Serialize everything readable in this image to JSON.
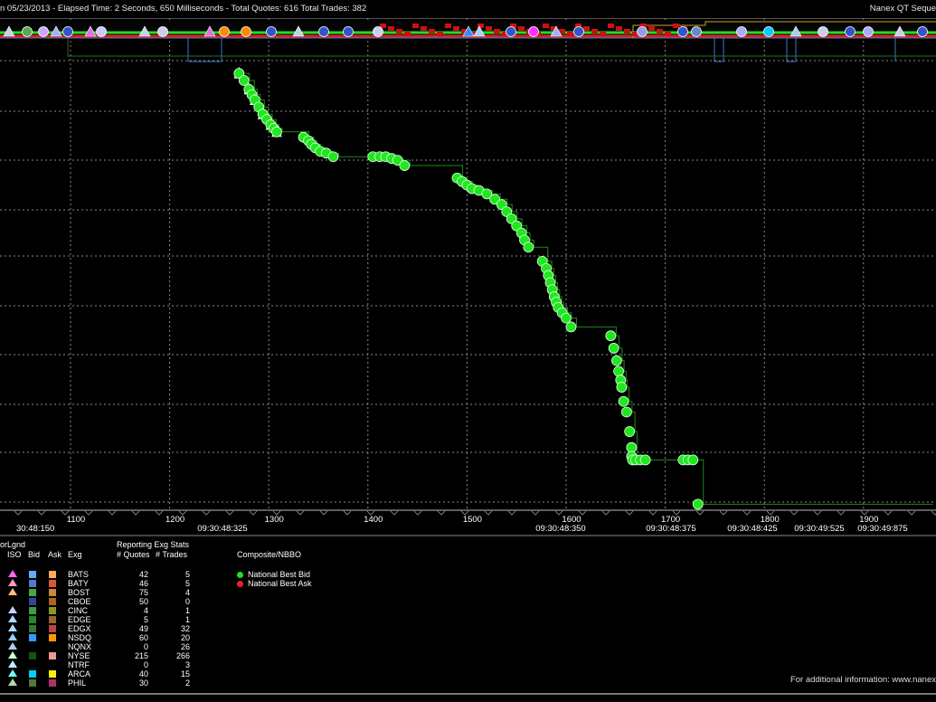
{
  "header": {
    "title": "n 05/23/2013  -  Elapsed Time: 2 Seconds, 650 Milliseconds  -  Total Quotes: 616  Total Trades: 382",
    "brand": "Nanex QT Seque"
  },
  "chart_data": {
    "type": "scatter",
    "title": "",
    "x": {
      "min": 1050,
      "max": 1980,
      "ticks": [
        1100,
        1200,
        1300,
        1400,
        1500,
        1600,
        1700,
        1800,
        1900
      ]
    },
    "time_labels": [
      "30:48:150",
      "09:30:48:325",
      "09:30:48:350",
      "09:30:48:375",
      "09:30:48:425",
      "09:30:49:525",
      "09:30:49:875"
    ],
    "grid": true,
    "series": [
      {
        "name": "National Best Bid",
        "color": "#00ee00",
        "points": [
          [
            1270,
            22
          ],
          [
            1275,
            26
          ],
          [
            1280,
            31
          ],
          [
            1283,
            34
          ],
          [
            1286,
            37
          ],
          [
            1290,
            41
          ],
          [
            1294,
            45
          ],
          [
            1298,
            48
          ],
          [
            1302,
            51
          ],
          [
            1305,
            53
          ],
          [
            1308,
            55
          ],
          [
            1335,
            58
          ],
          [
            1340,
            60
          ],
          [
            1343,
            62
          ],
          [
            1347,
            64
          ],
          [
            1352,
            66
          ],
          [
            1358,
            67
          ],
          [
            1365,
            69
          ],
          [
            1405,
            69
          ],
          [
            1412,
            69
          ],
          [
            1418,
            69
          ],
          [
            1424,
            70
          ],
          [
            1430,
            71
          ],
          [
            1437,
            74
          ],
          [
            1490,
            81
          ],
          [
            1495,
            83
          ],
          [
            1500,
            85
          ],
          [
            1505,
            87
          ],
          [
            1512,
            88
          ],
          [
            1520,
            90
          ],
          [
            1528,
            93
          ],
          [
            1535,
            96
          ],
          [
            1540,
            100
          ],
          [
            1545,
            104
          ],
          [
            1550,
            108
          ],
          [
            1555,
            112
          ],
          [
            1558,
            116
          ],
          [
            1562,
            120
          ],
          [
            1576,
            128
          ],
          [
            1580,
            132
          ],
          [
            1582,
            136
          ],
          [
            1584,
            140
          ],
          [
            1586,
            144
          ],
          [
            1588,
            148
          ],
          [
            1590,
            151
          ],
          [
            1592,
            154
          ],
          [
            1596,
            157
          ],
          [
            1600,
            160
          ],
          [
            1605,
            165
          ],
          [
            1645,
            170
          ],
          [
            1648,
            177
          ],
          [
            1651,
            184
          ],
          [
            1653,
            190
          ],
          [
            1655,
            195
          ],
          [
            1656,
            199
          ],
          [
            1658,
            207
          ],
          [
            1661,
            213
          ],
          [
            1664,
            224
          ],
          [
            1666,
            233
          ],
          [
            1666,
            238
          ],
          [
            1667,
            240
          ],
          [
            1670,
            240
          ],
          [
            1675,
            240
          ],
          [
            1680,
            240
          ],
          [
            1718,
            240
          ],
          [
            1723,
            240
          ],
          [
            1728,
            240
          ],
          [
            1733,
            265
          ]
        ]
      },
      {
        "name": "National Best Ask",
        "color": "#ff2200",
        "points": [
          [
            1330,
            16
          ],
          [
            1360,
            16
          ],
          [
            1390,
            16
          ],
          [
            1420,
            16
          ],
          [
            1450,
            16
          ],
          [
            1480,
            16
          ],
          [
            1520,
            16
          ],
          [
            1560,
            16
          ],
          [
            1600,
            16
          ]
        ]
      }
    ]
  },
  "legend": {
    "heading": "orLgnd",
    "cols": {
      "iso": "ISO",
      "bid": "Bid",
      "ask": "Ask",
      "exg": "Exg"
    },
    "stats_title": "Reporting Exg Stats",
    "quotes_label": "# Quotes",
    "trades_label": "# Trades",
    "nbbo_title": "Composite/NBBO",
    "nbbo_items": [
      {
        "label": "National Best Bid",
        "color": "#22dd22"
      },
      {
        "label": "National Best Ask",
        "color": "#ee2222"
      }
    ],
    "rows": [
      {
        "exg": "BATS",
        "quotes": "42",
        "trades": "5",
        "iso": "#ff66ff",
        "bid": "#66aaff",
        "ask": "#ffaa55"
      },
      {
        "exg": "BATY",
        "quotes": "46",
        "trades": "5",
        "iso": "#ff99cc",
        "bid": "#5577cc",
        "ask": "#dd5533"
      },
      {
        "exg": "BOST",
        "quotes": "75",
        "trades": "4",
        "iso": "#ffbb77",
        "bid": "#44aa44",
        "ask": "#cc8833"
      },
      {
        "exg": "CBOE",
        "quotes": "50",
        "trades": "0",
        "iso": "",
        "bid": "#334499",
        "ask": "#aa6622"
      },
      {
        "exg": "CINC",
        "quotes": "4",
        "trades": "1",
        "iso": "#ccccff",
        "bid": "#449944",
        "ask": "#889922"
      },
      {
        "exg": "EDGE",
        "quotes": "5",
        "trades": "1",
        "iso": "#aaddff",
        "bid": "#228822",
        "ask": "#996633"
      },
      {
        "exg": "EDGX",
        "quotes": "49",
        "trades": "32",
        "iso": "#aaddff",
        "bid": "#337733",
        "ask": "#bb4444"
      },
      {
        "exg": "NSDQ",
        "quotes": "60",
        "trades": "20",
        "iso": "#99ccff",
        "bid": "#3399ff",
        "ask": "#ff9900"
      },
      {
        "exg": "NQNX",
        "quotes": "0",
        "trades": "26",
        "iso": "#aaccee",
        "bid": "",
        "ask": ""
      },
      {
        "exg": "NYSE",
        "quotes": "215",
        "trades": "266",
        "iso": "#ccffcc",
        "bid": "#115511",
        "ask": "#ee9999"
      },
      {
        "exg": "NTRF",
        "quotes": "0",
        "trades": "3",
        "iso": "#bbeeff",
        "bid": "",
        "ask": ""
      },
      {
        "exg": "ARCA",
        "quotes": "40",
        "trades": "15",
        "iso": "#66ffff",
        "bid": "#00ccff",
        "ask": "#ffee00"
      },
      {
        "exg": "PHIL",
        "quotes": "30",
        "trades": "2",
        "iso": "#aaddaa",
        "bid": "#557733",
        "ask": "#aa3366"
      }
    ]
  },
  "footer": {
    "text": "For additional information: www.nanex"
  }
}
